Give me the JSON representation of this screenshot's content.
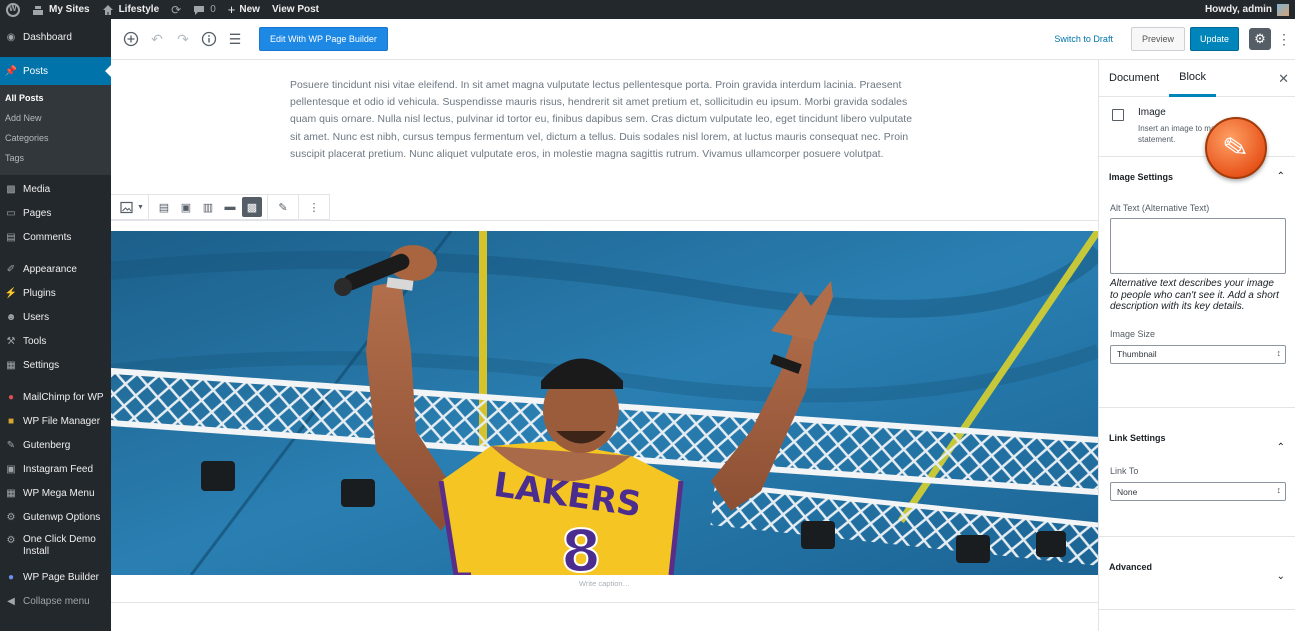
{
  "adminbar": {
    "my_sites": "My Sites",
    "site_name": "Lifestyle",
    "comments_count": "0",
    "new_label": "New",
    "view_post": "View Post",
    "howdy": "Howdy, admin"
  },
  "menu": {
    "dashboard": "Dashboard",
    "posts": "Posts",
    "posts_sub": [
      "All Posts",
      "Add New",
      "Categories",
      "Tags"
    ],
    "media": "Media",
    "pages": "Pages",
    "comments": "Comments",
    "appearance": "Appearance",
    "plugins": "Plugins",
    "users": "Users",
    "tools": "Tools",
    "settings": "Settings",
    "mailchimp": "MailChimp for WP",
    "file_manager": "WP File Manager",
    "gutenberg": "Gutenberg",
    "instagram": "Instagram Feed",
    "mega_menu": "WP Mega Menu",
    "gutenwp": "Gutenwp Options",
    "one_click": "One Click Demo Install",
    "page_builder": "WP Page Builder",
    "collapse": "Collapse menu"
  },
  "header": {
    "wpb_button": "Edit With WP Page Builder",
    "switch_draft": "Switch to Draft",
    "preview": "Preview",
    "update": "Update"
  },
  "content": {
    "paragraph": "Posuere tincidunt nisi vitae eleifend. In sit amet magna vulputate lectus pellentesque porta. Proin gravida interdum lacinia. Praesent pellentesque et odio id vehicula. Suspendisse mauris risus, hendrerit sit amet pretium et, sollicitudin eu ipsum. Morbi gravida sodales quam quis ornare. Nulla nisl lectus, pulvinar id tortor eu, finibus dapibus sem. Cras dictum vulputate leo, eget tincidunt libero vulputate sit amet. Nunc est nibh, cursus tempus fermentum vel, dictum a tellus. Duis sodales nisl lorem, at luctus mauris consequat nec. Proin suscipit placerat pretium. Nunc aliquet vulputate eros, in molestie magna sagittis rutrum. Vivamus ullamcorper posuere volutpat.",
    "caption_placeholder": "Write caption…",
    "jersey_text": "LAKERS",
    "jersey_number": "8"
  },
  "sidebar": {
    "tab_document": "Document",
    "tab_block": "Block",
    "block_title": "Image",
    "block_desc": "Insert an image to make a visual statement.",
    "image_settings": "Image Settings",
    "alt_label": "Alt Text (Alternative Text)",
    "alt_help": "Alternative text describes your image to people who can't see it. Add a short description with its key details.",
    "image_size_label": "Image Size",
    "image_size_value": "Thumbnail",
    "link_settings": "Link Settings",
    "link_to_label": "Link To",
    "link_to_value": "None",
    "advanced": "Advanced"
  },
  "colors": {
    "admin_dark": "#23282d",
    "accent_blue": "#0073aa",
    "update_blue": "#0085ba",
    "wpb_blue": "#1e88e5",
    "badge_orange": "#e8561d"
  }
}
